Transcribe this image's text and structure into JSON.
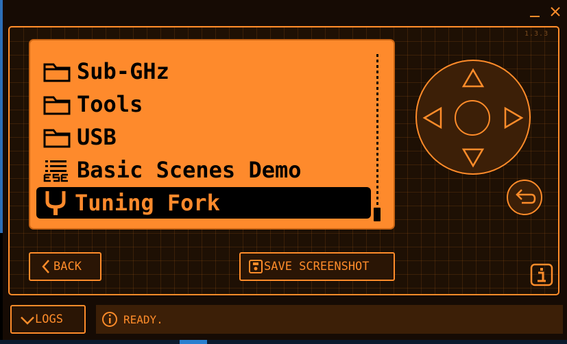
{
  "window": {
    "version": "1.3.3",
    "minimize_icon": "minimize-icon",
    "close_icon": "close-icon"
  },
  "screen": {
    "menu_items": [
      {
        "label": "Sub-GHz",
        "icon": "folder-icon",
        "selected": false
      },
      {
        "label": "Tools",
        "icon": "folder-icon",
        "selected": false
      },
      {
        "label": "USB",
        "icon": "folder-icon",
        "selected": false
      },
      {
        "label": "Basic Scenes Demo",
        "icon": "app-icon",
        "selected": false
      },
      {
        "label": "Tuning Fork",
        "icon": "tuning-fork-icon",
        "selected": true
      }
    ],
    "scroll_position": 1.0
  },
  "controls": {
    "dpad": [
      "up",
      "down",
      "left",
      "right",
      "ok"
    ],
    "back_round_icon": "return-icon"
  },
  "buttons": {
    "back_label": "BACK",
    "save_label": "SAVE SCREENSHOT",
    "logs_label": "LOGS"
  },
  "status": {
    "text": "READY."
  },
  "colors": {
    "accent": "#ff8c2a",
    "screen_bg": "#fe8a2c",
    "panel_bg": "#1e1004",
    "dark_fill": "#3c1f07"
  }
}
